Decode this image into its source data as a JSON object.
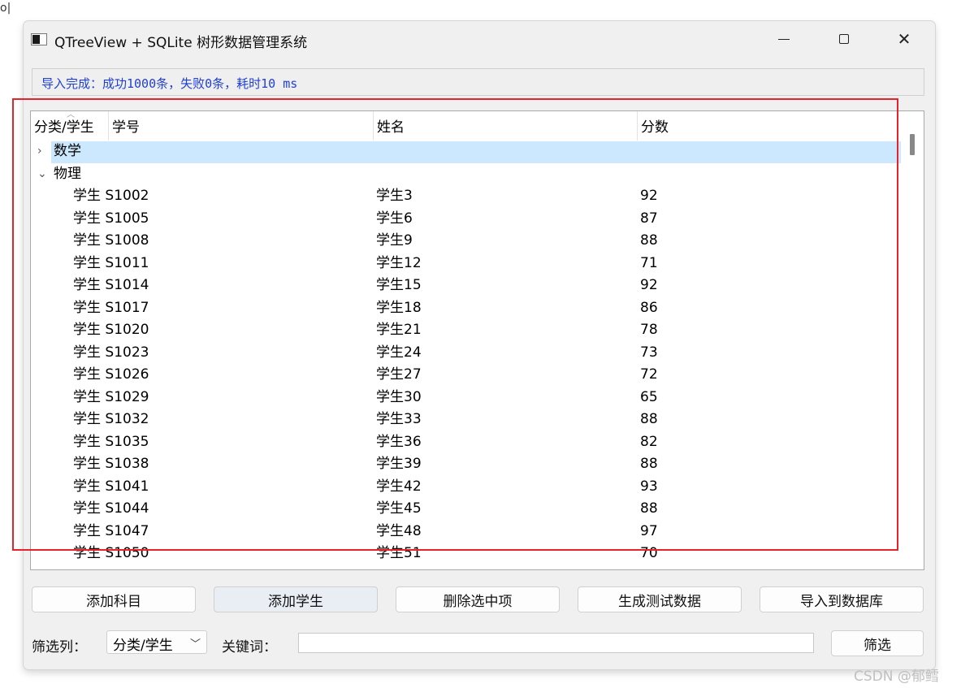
{
  "corner_mark": "o|",
  "window": {
    "title": "QTreeView + SQLite 树形数据管理系统",
    "minimize_label": "",
    "maximize_label": "",
    "close_label": "✕"
  },
  "status": {
    "text": "导入完成：成功1000条，失败0条，耗时10 ms",
    "color": "#1f3fd6"
  },
  "tree": {
    "columns": [
      "分类/学生",
      "学号",
      "姓名",
      "分数"
    ],
    "groups": [
      {
        "label": "数学",
        "expanded": false,
        "selected": true,
        "branch_icon": "chevron-right-icon"
      },
      {
        "label": "物理",
        "expanded": true,
        "selected": false,
        "branch_icon": "chevron-down-icon"
      }
    ],
    "students": [
      {
        "id": "学生 S1002",
        "name": "学生3",
        "score": "92"
      },
      {
        "id": "学生 S1005",
        "name": "学生6",
        "score": "87"
      },
      {
        "id": "学生 S1008",
        "name": "学生9",
        "score": "88"
      },
      {
        "id": "学生 S1011",
        "name": "学生12",
        "score": "71"
      },
      {
        "id": "学生 S1014",
        "name": "学生15",
        "score": "92"
      },
      {
        "id": "学生 S1017",
        "name": "学生18",
        "score": "86"
      },
      {
        "id": "学生 S1020",
        "name": "学生21",
        "score": "78"
      },
      {
        "id": "学生 S1023",
        "name": "学生24",
        "score": "73"
      },
      {
        "id": "学生 S1026",
        "name": "学生27",
        "score": "72"
      },
      {
        "id": "学生 S1029",
        "name": "学生30",
        "score": "65"
      },
      {
        "id": "学生 S1032",
        "name": "学生33",
        "score": "88"
      },
      {
        "id": "学生 S1035",
        "name": "学生36",
        "score": "82"
      },
      {
        "id": "学生 S1038",
        "name": "学生39",
        "score": "88"
      },
      {
        "id": "学生 S1041",
        "name": "学生42",
        "score": "93"
      },
      {
        "id": "学生 S1044",
        "name": "学生45",
        "score": "88"
      },
      {
        "id": "学生 S1047",
        "name": "学生48",
        "score": "97"
      },
      {
        "id": "学生 S1050",
        "name": "学生51",
        "score": "70"
      }
    ],
    "selection_color": "#cce8ff",
    "highlight_color": "#e8222d"
  },
  "buttons": {
    "add_subject": "添加科目",
    "add_student": "添加学生",
    "delete_selected": "删除选中项",
    "generate_test_data": "生成测试数据",
    "import_to_db": "导入到数据库"
  },
  "filter": {
    "column_label": "筛选列：",
    "column_value": "分类/学生",
    "keyword_label": "关键词：",
    "keyword_value": "",
    "filter_button": "筛选"
  },
  "watermark": "CSDN @郁鳕"
}
